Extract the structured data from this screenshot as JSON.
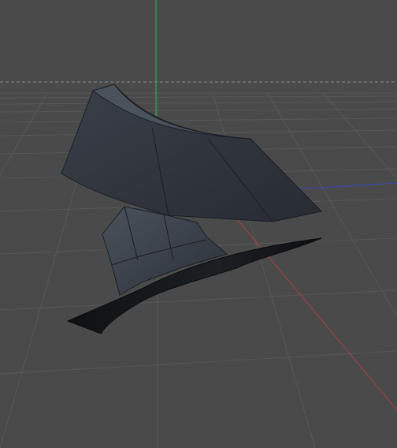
{
  "viewport": {
    "kind": "3d-perspective-viewport",
    "background_color": "#4a4a4a",
    "grid_color": "#5a5a5a",
    "axis_colors": {
      "x": "#3b47c9",
      "y": "#2fb84a",
      "z": "#a94242"
    },
    "horizon_line_style": "dashed",
    "objects": [
      {
        "name": "upper-curved-sheet",
        "color": "#2f353d",
        "edge_color": "#1b1f24"
      },
      {
        "name": "lower-curved-sheet",
        "color": "#3a414b",
        "edge_color": "#1b1f24"
      },
      {
        "name": "ground-fin-strip",
        "color": "#17191c",
        "edge_color": "#0a0b0c"
      }
    ]
  }
}
